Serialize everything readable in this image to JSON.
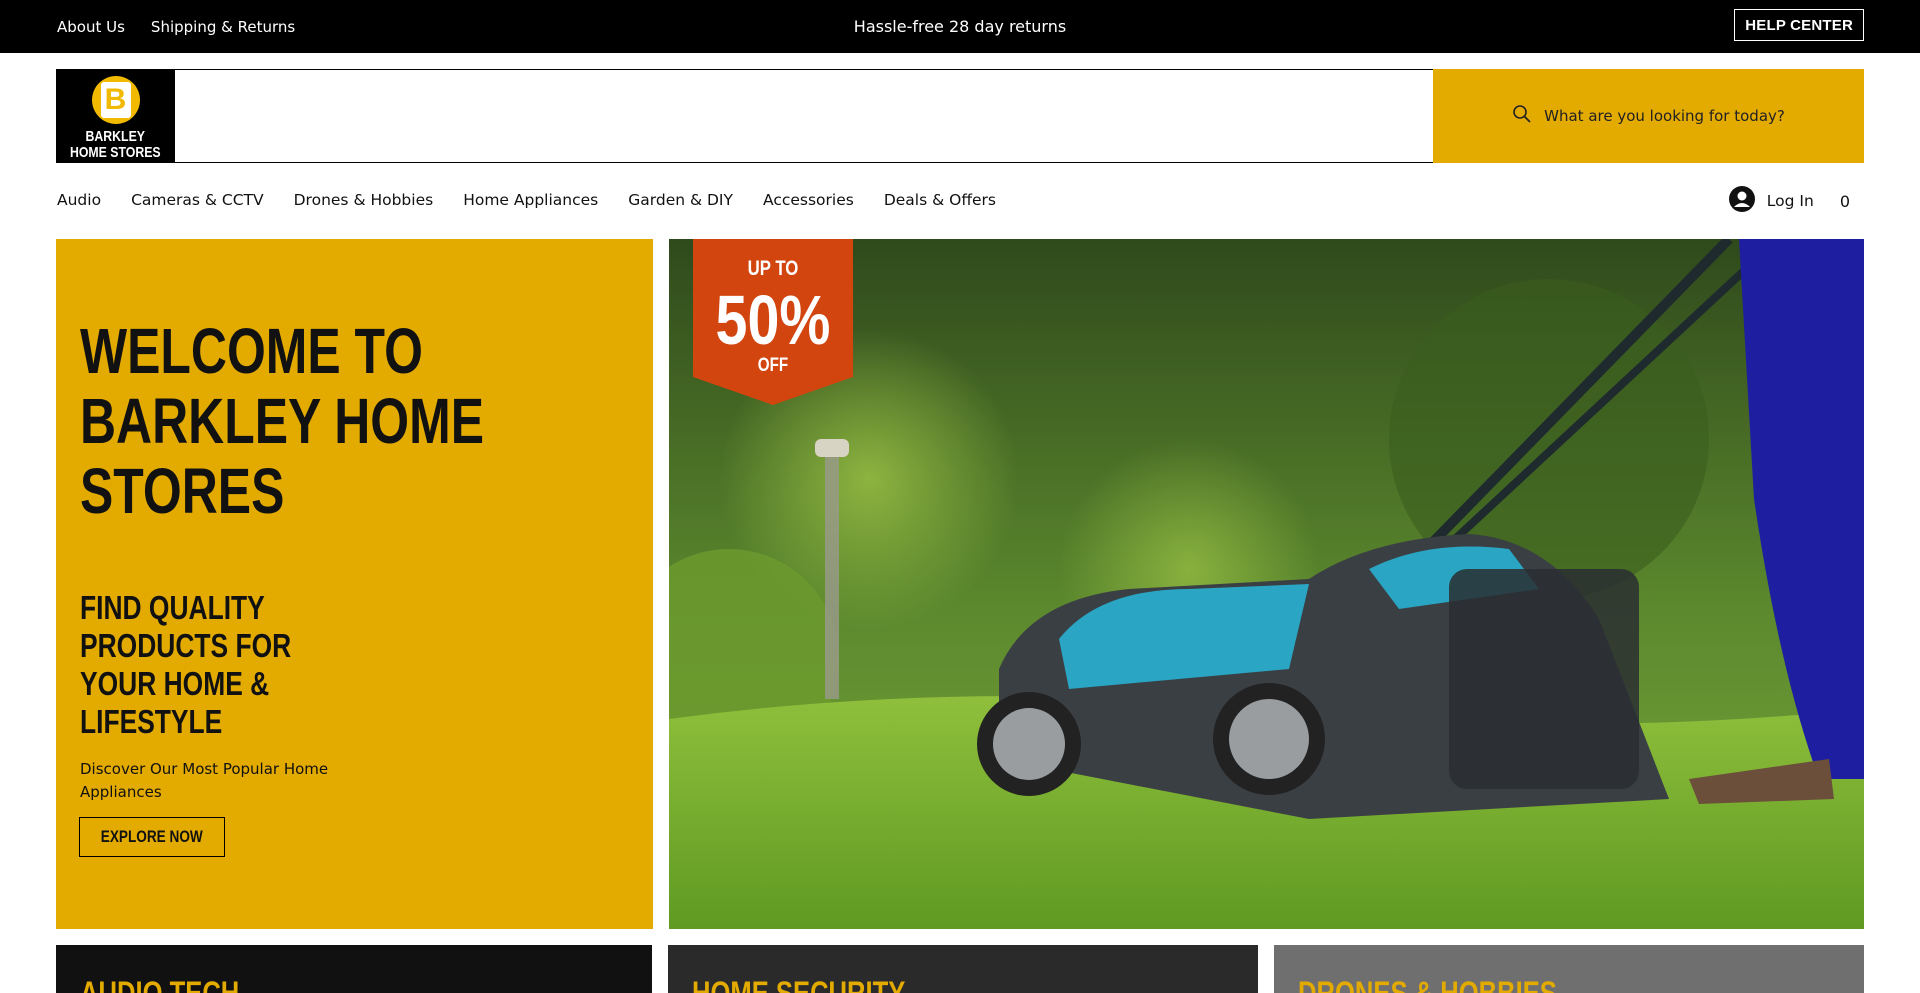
{
  "topbar": {
    "links": [
      "About Us",
      "Shipping & Returns"
    ],
    "promo": "Hassle-free 28 day returns",
    "help_label": "HELP CENTER"
  },
  "header": {
    "logo_line1": "BARKLEY",
    "logo_line2": "HOME STORES",
    "logo_letter": "B",
    "search_placeholder": "What are you looking for today?"
  },
  "nav": {
    "items": [
      "Audio",
      "Cameras & CCTV",
      "Drones & Hobbies",
      "Home Appliances",
      "Garden & DIY",
      "Accessories",
      "Deals & Offers"
    ]
  },
  "account": {
    "login_label": "Log In",
    "cart_count": "0"
  },
  "hero": {
    "headline": "WELCOME TO BARKLEY HOME STORES",
    "subheadline": "FIND QUALITY PRODUCTS FOR YOUR HOME & LIFESTYLE",
    "description": "Discover Our Most Popular Home Appliances",
    "cta_label": "EXPLORE NOW",
    "promo_top": "UP TO",
    "promo_value": "50%",
    "promo_bottom": "OFF"
  },
  "categories": [
    {
      "title": "AUDIO TECH"
    },
    {
      "title": "HOME SECURITY"
    },
    {
      "title": "DRONES & HOBBIES"
    }
  ],
  "colors": {
    "brand_yellow": "#e3aa00",
    "promo_orange": "#d2450f",
    "topbar_bg": "#000000"
  }
}
